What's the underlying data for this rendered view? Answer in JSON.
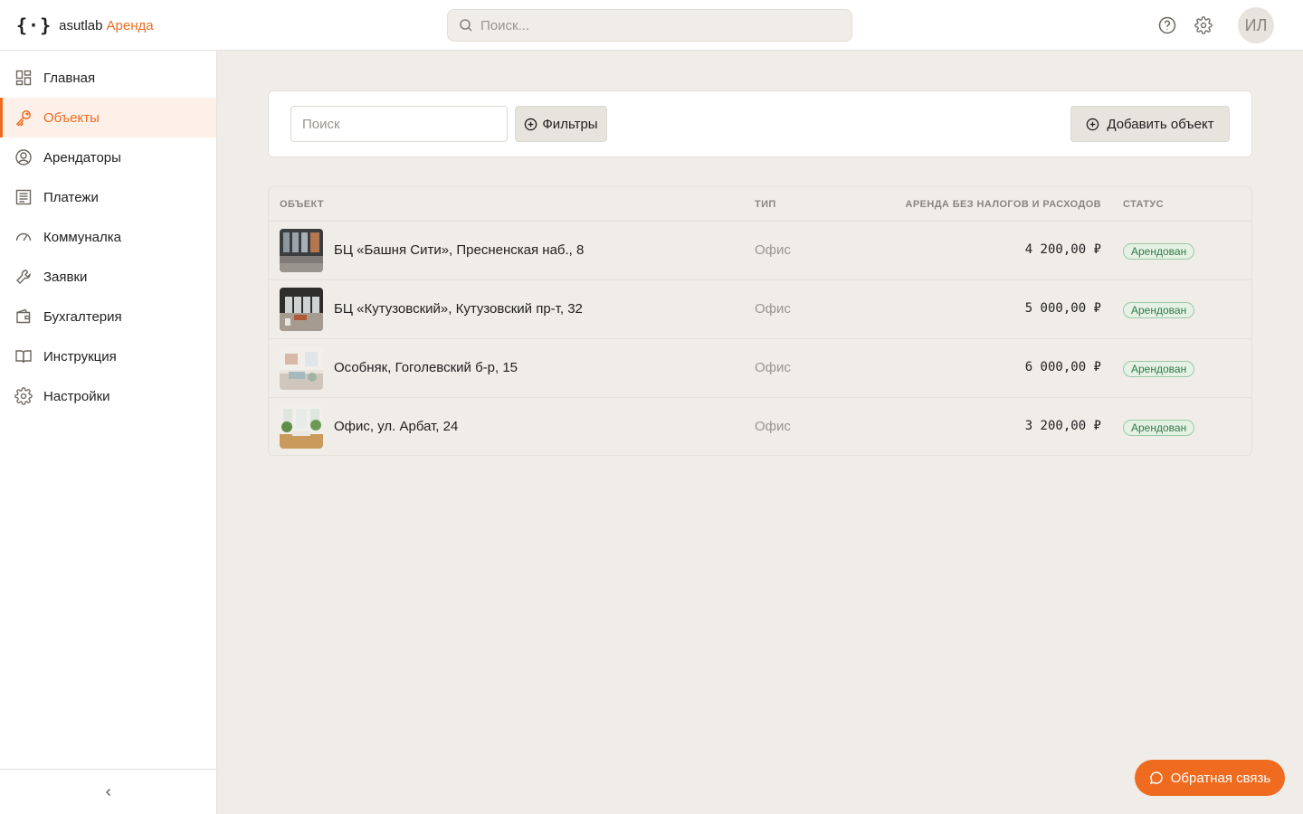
{
  "app": {
    "logo_mark": "{·}",
    "brand": "asutlab",
    "product": "Аренда"
  },
  "header": {
    "search_placeholder": "Поиск...",
    "avatar_initials": "ИЛ",
    "icons": [
      "help-icon",
      "gear-icon"
    ]
  },
  "sidebar": {
    "items": [
      {
        "label": "Главная",
        "icon": "dashboard-icon",
        "active": false
      },
      {
        "label": "Объекты",
        "icon": "key-icon",
        "active": true
      },
      {
        "label": "Арендаторы",
        "icon": "user-circle-icon",
        "active": false
      },
      {
        "label": "Платежи",
        "icon": "receipt-icon",
        "active": false
      },
      {
        "label": "Коммуналка",
        "icon": "gauge-icon",
        "active": false
      },
      {
        "label": "Заявки",
        "icon": "wrench-icon",
        "active": false
      },
      {
        "label": "Бухгалтерия",
        "icon": "wallet-icon",
        "active": false
      },
      {
        "label": "Инструкция",
        "icon": "book-icon",
        "active": false
      },
      {
        "label": "Настройки",
        "icon": "gear-icon",
        "active": false
      }
    ],
    "collapse_icon": "chevron-left-icon"
  },
  "toolbar": {
    "search_placeholder": "Поиск",
    "filters_label": "Фильтры",
    "add_label": "Добавить объект"
  },
  "table": {
    "columns": {
      "object": "ОБЪЕКТ",
      "type": "ТИП",
      "rent": "АРЕНДА БЕЗ НАЛОГОВ И РАСХОДОВ",
      "status": "СТАТУС"
    },
    "rows": [
      {
        "name": "БЦ «Башня Сити», Пресненская наб., 8",
        "type": "Офис",
        "rent": "4 200,00 ₽",
        "status": "Арендован"
      },
      {
        "name": "БЦ «Кутузовский», Кутузовский пр-т, 32",
        "type": "Офис",
        "rent": "5 000,00 ₽",
        "status": "Арендован"
      },
      {
        "name": "Особняк, Гоголевский б-р, 15",
        "type": "Офис",
        "rent": "6 000,00 ₽",
        "status": "Арендован"
      },
      {
        "name": "Офис, ул. Арбат, 24",
        "type": "Офис",
        "rent": "3 200,00 ₽",
        "status": "Арендован"
      }
    ]
  },
  "feedback": {
    "label": "Обратная связь",
    "icon": "chat-icon"
  },
  "colors": {
    "accent": "#ee6b1f",
    "background": "#f0ede8",
    "status_green": "#2f7a44"
  }
}
